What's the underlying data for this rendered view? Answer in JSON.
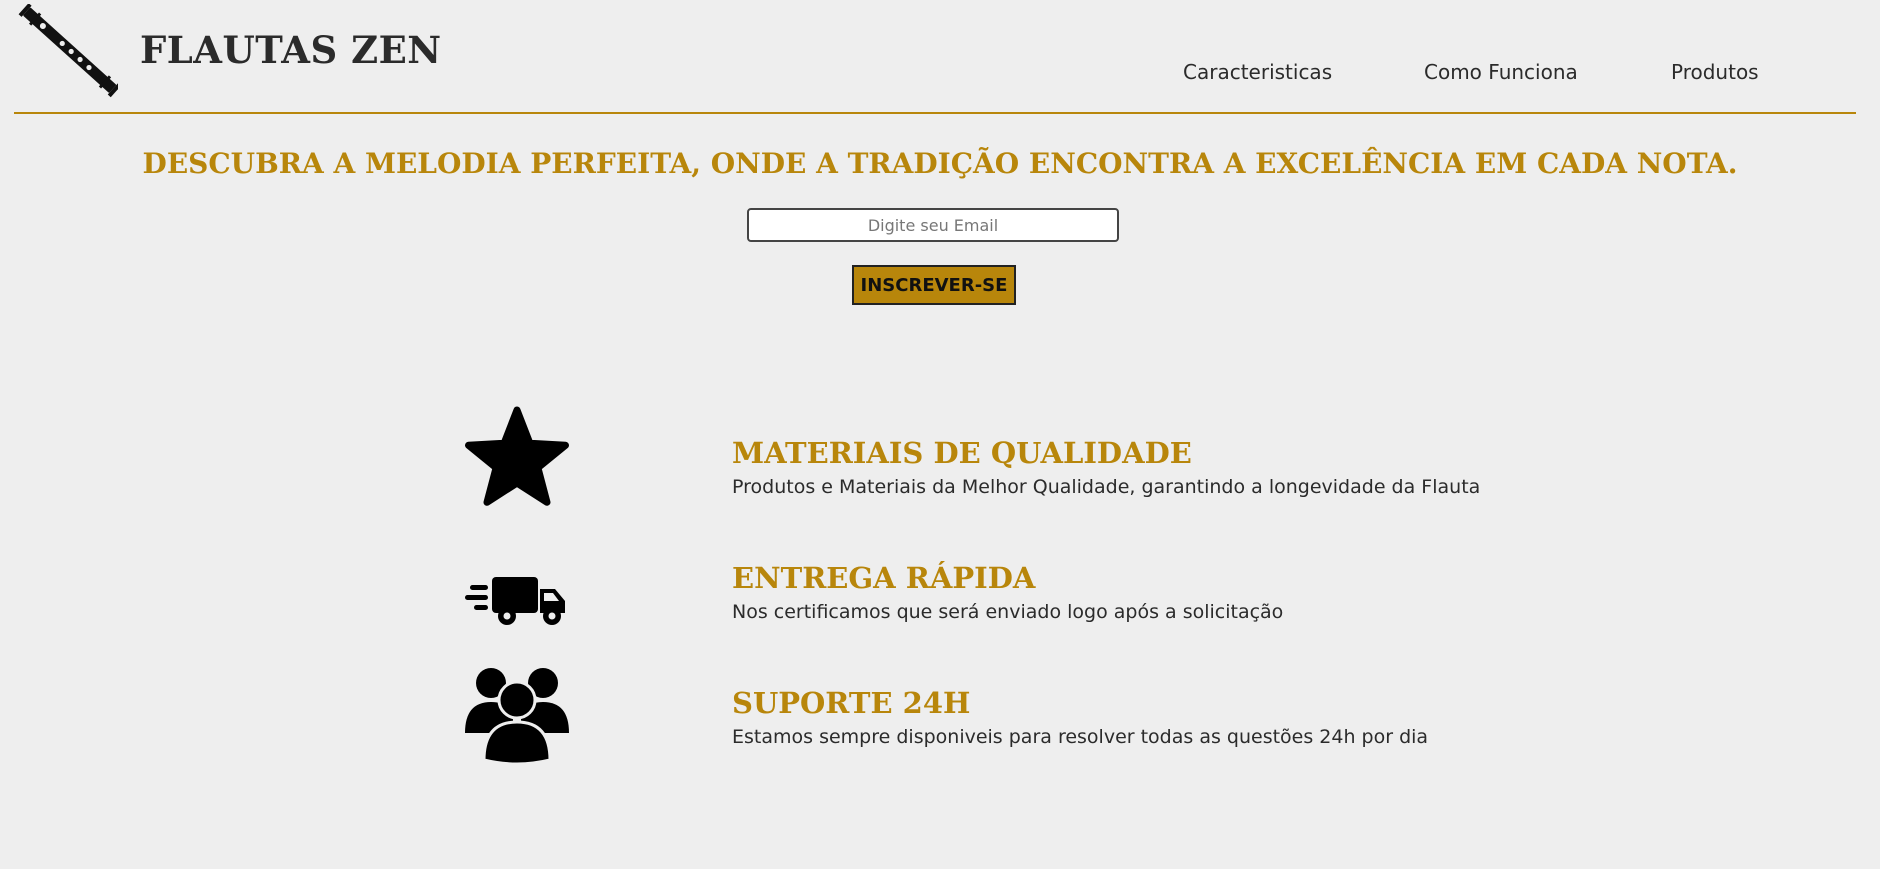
{
  "header": {
    "brand": "FLAUTAS ZEN",
    "logo_icon": "flute-icon",
    "nav": [
      {
        "label": "Caracteristicas"
      },
      {
        "label": "Como Funciona"
      },
      {
        "label": "Produtos"
      }
    ]
  },
  "hero": {
    "headline": "DESCUBRA A MELODIA PERFEITA, ONDE A TRADIÇÃO ENCONTRA A EXCELÊNCIA EM CADA NOTA.",
    "email_value": "",
    "email_placeholder": "Digite seu Email",
    "subscribe_label": "INSCREVER-SE"
  },
  "features": [
    {
      "icon": "star-icon",
      "title": "MATERIAIS DE QUALIDADE",
      "text": "Produtos e Materiais da Melhor Qualidade, garantindo a longevidade da Flauta"
    },
    {
      "icon": "delivery-truck-icon",
      "title": "ENTREGA RÁPIDA",
      "text": "Nos certificamos que será enviado logo após a solicitação"
    },
    {
      "icon": "users-icon",
      "title": "SUPORTE 24H",
      "text": "Estamos sempre disponiveis para resolver todas as questões 24h por dia"
    }
  ],
  "colors": {
    "background": "#eeeeee",
    "accent": "#b8860b",
    "text": "#2b2b2b"
  }
}
